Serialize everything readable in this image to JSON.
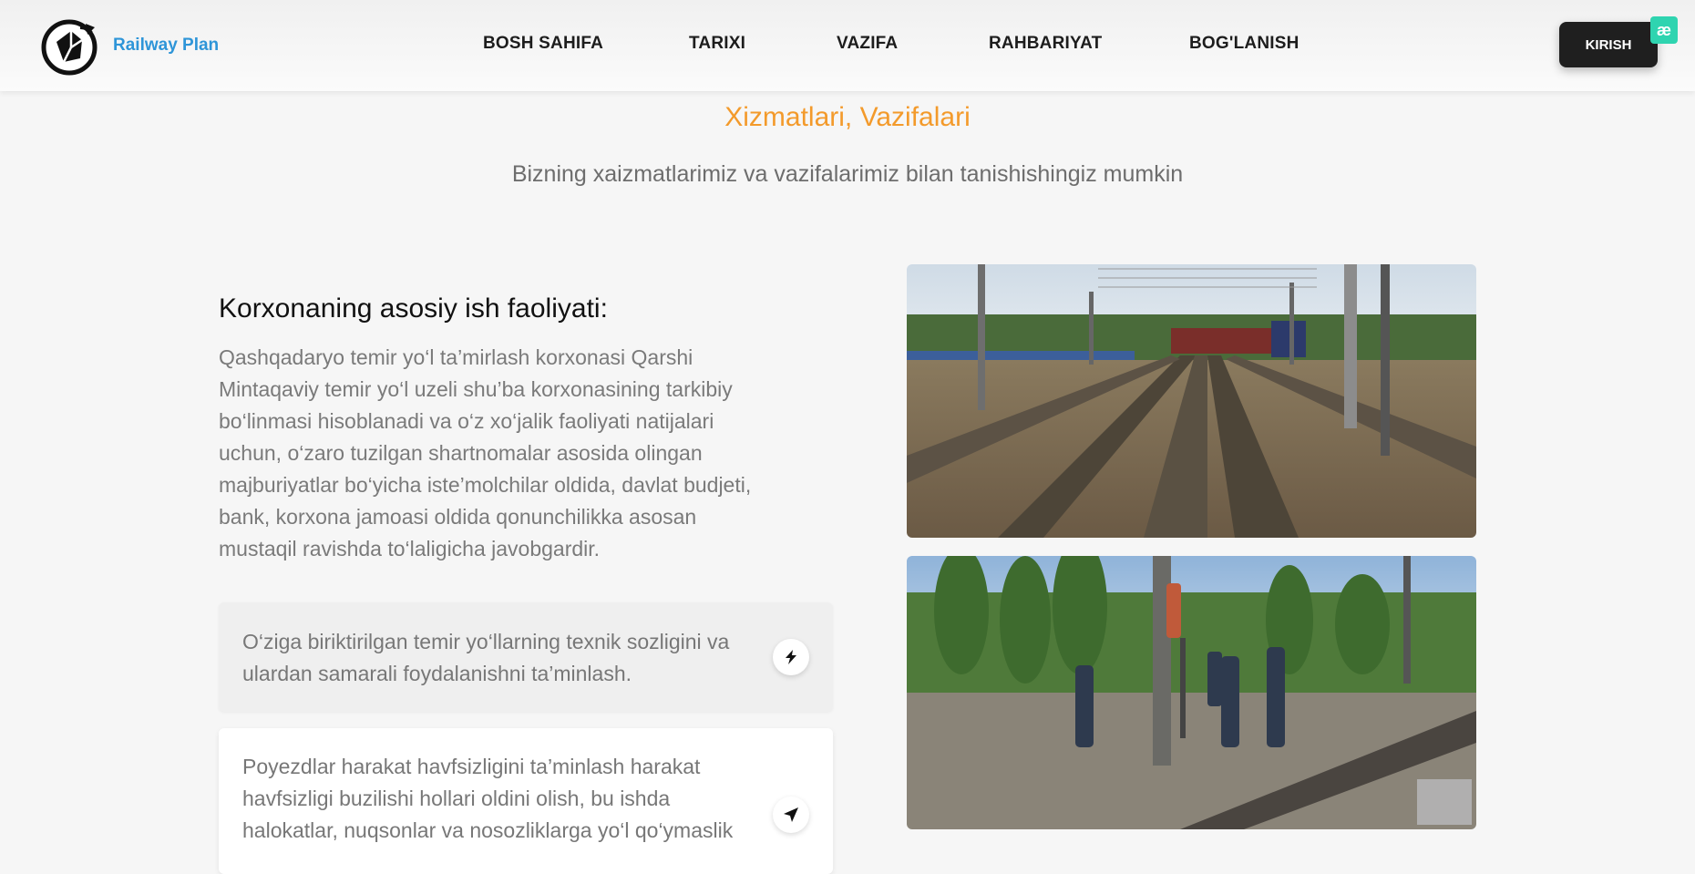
{
  "header": {
    "brand": "Railway Plan",
    "nav": [
      {
        "label": "BOSH SAHIFA"
      },
      {
        "label": "TARIXI"
      },
      {
        "label": "VAZIFA"
      },
      {
        "label": "RAHBARIYAT"
      },
      {
        "label": "BOG'LANISH"
      }
    ],
    "login_label": "KIRISH",
    "badge_glyph": "æ"
  },
  "section": {
    "title": "Xizmatlari, Vazifalari",
    "subtitle": "Bizning xaizmatlarimiz va vazifalarimiz bilan tanishishingiz mumkin"
  },
  "content": {
    "title": "Korxonaning asosiy ish faoliyati:",
    "text": "Qashqadaryo temir yo‘l ta’mirlash korxonasi Qarshi Mintaqaviy temir yo‘l uzeli shu’ba korxonasining tarkibiy bo‘linmasi hisoblanadi va o‘z xo‘jalik faoliyati natijalari uchun, o‘zaro tuzilgan shartnomalar asosida olingan majburiyatlar bo‘yicha iste’molchilar oldida, davlat budjeti, bank, korxona jamoasi oldida qonunchilikka asosan mustaqil ravishda to‘laligicha javobgardir.",
    "cards": [
      {
        "text": "O‘ziga biriktirilgan temir yo‘llarning texnik sozligini va ulardan samarali foydalanishni ta’minlash.",
        "icon": "bolt-icon"
      },
      {
        "text": "Poyezdlar harakat havfsizligini ta’minlash harakat havfsizligi buzilishi hollari oldini olish, bu ishda halokatlar, nuqsonlar va nosozliklarga yo‘l qo‘ymaslik",
        "icon": "navigation-arrow-icon"
      }
    ]
  },
  "colors": {
    "brand": "#2e95d8",
    "accent": "#f39a2b",
    "button_bg": "#1f1f1f",
    "badge": "#2fd4b0"
  }
}
